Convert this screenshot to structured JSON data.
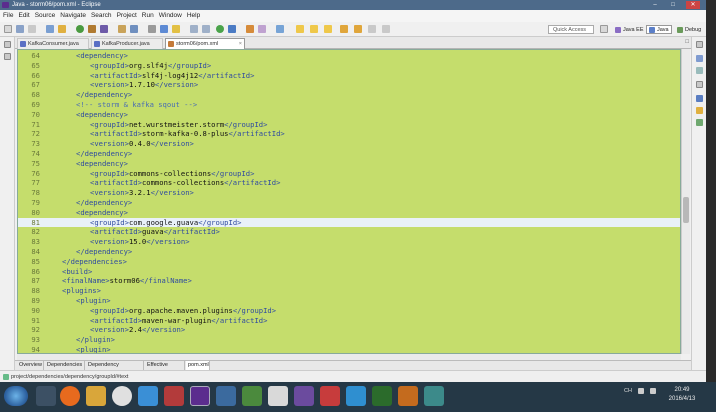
{
  "window": {
    "title": "Java - storm06/pom.xml - Eclipse"
  },
  "menu": [
    "File",
    "Edit",
    "Source",
    "Navigate",
    "Search",
    "Project",
    "Run",
    "Window",
    "Help"
  ],
  "toolbar": {
    "quick_access": "Quick Access",
    "perspectives": [
      "Java EE",
      "Java",
      "Debug"
    ]
  },
  "tabs": [
    {
      "label": "KafkaConsumer.java",
      "active": false
    },
    {
      "label": "KafkaProducer.java",
      "active": false
    },
    {
      "label": "storm06/pom.xml",
      "active": true
    }
  ],
  "editor": {
    "current_line": 81,
    "lines": [
      {
        "n": "64",
        "indent": 2,
        "parts": [
          [
            "tag",
            "<dependency>"
          ]
        ]
      },
      {
        "n": "65",
        "indent": 3,
        "parts": [
          [
            "tag",
            "<groupId>"
          ],
          [
            "txt",
            "org.slf4j"
          ],
          [
            "tag",
            "</groupId>"
          ]
        ]
      },
      {
        "n": "66",
        "indent": 3,
        "parts": [
          [
            "tag",
            "<artifactId>"
          ],
          [
            "txt",
            "slf4j-log4j12"
          ],
          [
            "tag",
            "</artifactId>"
          ]
        ]
      },
      {
        "n": "67",
        "indent": 3,
        "parts": [
          [
            "tag",
            "<version>"
          ],
          [
            "txt",
            "1.7.10"
          ],
          [
            "tag",
            "</version>"
          ]
        ]
      },
      {
        "n": "68",
        "indent": 2,
        "parts": [
          [
            "tag",
            "</dependency>"
          ]
        ]
      },
      {
        "n": "69",
        "indent": 2,
        "parts": [
          [
            "cmt",
            "<!-- storm & kafka sqout -->"
          ]
        ]
      },
      {
        "n": "70",
        "indent": 2,
        "parts": [
          [
            "tag",
            "<dependency>"
          ]
        ]
      },
      {
        "n": "71",
        "indent": 3,
        "parts": [
          [
            "tag",
            "<groupId>"
          ],
          [
            "txt",
            "net.wurstmeister.storm"
          ],
          [
            "tag",
            "</groupId>"
          ]
        ]
      },
      {
        "n": "72",
        "indent": 3,
        "parts": [
          [
            "tag",
            "<artifactId>"
          ],
          [
            "txt",
            "storm-kafka-0.8-plus"
          ],
          [
            "tag",
            "</artifactId>"
          ]
        ]
      },
      {
        "n": "73",
        "indent": 3,
        "parts": [
          [
            "tag",
            "<version>"
          ],
          [
            "txt",
            "0.4.0"
          ],
          [
            "tag",
            "</version>"
          ]
        ]
      },
      {
        "n": "74",
        "indent": 2,
        "parts": [
          [
            "tag",
            "</dependency>"
          ]
        ]
      },
      {
        "n": "75",
        "indent": 2,
        "parts": [
          [
            "tag",
            "<dependency>"
          ]
        ]
      },
      {
        "n": "76",
        "indent": 3,
        "parts": [
          [
            "tag",
            "<groupId>"
          ],
          [
            "txt",
            "commons-collections"
          ],
          [
            "tag",
            "</groupId>"
          ]
        ]
      },
      {
        "n": "77",
        "indent": 3,
        "parts": [
          [
            "tag",
            "<artifactId>"
          ],
          [
            "txt",
            "commons-collections"
          ],
          [
            "tag",
            "</artifactId>"
          ]
        ]
      },
      {
        "n": "78",
        "indent": 3,
        "parts": [
          [
            "tag",
            "<version>"
          ],
          [
            "txt",
            "3.2.1"
          ],
          [
            "tag",
            "</version>"
          ]
        ]
      },
      {
        "n": "79",
        "indent": 2,
        "parts": [
          [
            "tag",
            "</dependency>"
          ]
        ]
      },
      {
        "n": "80",
        "indent": 2,
        "parts": [
          [
            "tag",
            "<dependency>"
          ]
        ]
      },
      {
        "n": "81",
        "indent": 3,
        "parts": [
          [
            "tag",
            "<groupId>"
          ],
          [
            "txt",
            "com.google.guava"
          ],
          [
            "tag",
            "</groupId>"
          ]
        ]
      },
      {
        "n": "82",
        "indent": 3,
        "parts": [
          [
            "tag",
            "<artifactId>"
          ],
          [
            "txt",
            "guava"
          ],
          [
            "tag",
            "</artifactId>"
          ]
        ]
      },
      {
        "n": "83",
        "indent": 3,
        "parts": [
          [
            "tag",
            "<version>"
          ],
          [
            "txt",
            "15.0"
          ],
          [
            "tag",
            "</version>"
          ]
        ]
      },
      {
        "n": "84",
        "indent": 2,
        "parts": [
          [
            "tag",
            "</dependency>"
          ]
        ]
      },
      {
        "n": "85",
        "indent": 1,
        "parts": [
          [
            "tag",
            "</dependencies>"
          ]
        ]
      },
      {
        "n": "86",
        "indent": 1,
        "parts": [
          [
            "tag",
            "<build>"
          ]
        ]
      },
      {
        "n": "87",
        "indent": 1,
        "parts": [
          [
            "tag",
            "<finalName>"
          ],
          [
            "txt",
            "storm06"
          ],
          [
            "tag",
            "</finalName>"
          ]
        ]
      },
      {
        "n": "88",
        "indent": 1,
        "parts": [
          [
            "tag",
            "<plugins>"
          ]
        ]
      },
      {
        "n": "89",
        "indent": 2,
        "parts": [
          [
            "tag",
            "<plugin>"
          ]
        ]
      },
      {
        "n": "90",
        "indent": 3,
        "parts": [
          [
            "tag",
            "<groupId>"
          ],
          [
            "txt",
            "org.apache.maven.plugins"
          ],
          [
            "tag",
            "</groupId>"
          ]
        ]
      },
      {
        "n": "91",
        "indent": 3,
        "parts": [
          [
            "tag",
            "<artifactId>"
          ],
          [
            "txt",
            "maven-war-plugin"
          ],
          [
            "tag",
            "</artifactId>"
          ]
        ]
      },
      {
        "n": "92",
        "indent": 3,
        "parts": [
          [
            "tag",
            "<version>"
          ],
          [
            "txt",
            "2.4"
          ],
          [
            "tag",
            "</version>"
          ]
        ]
      },
      {
        "n": "93",
        "indent": 2,
        "parts": [
          [
            "tag",
            "</plugin>"
          ]
        ]
      },
      {
        "n": "94",
        "indent": 2,
        "parts": [
          [
            "tag",
            "<plugin>"
          ]
        ]
      }
    ]
  },
  "bottom_tabs": [
    {
      "label": "Overview",
      "active": false
    },
    {
      "label": "Dependencies",
      "active": false
    },
    {
      "label": "Dependency Hierarchy",
      "active": false
    },
    {
      "label": "Effective POM",
      "active": false
    },
    {
      "label": "pom.xml",
      "active": true
    }
  ],
  "status": {
    "path": "project/dependencies/dependency/groupId/#text"
  },
  "taskbar": {
    "tray": "CH",
    "time": "20:49",
    "date": "2016/4/13"
  }
}
